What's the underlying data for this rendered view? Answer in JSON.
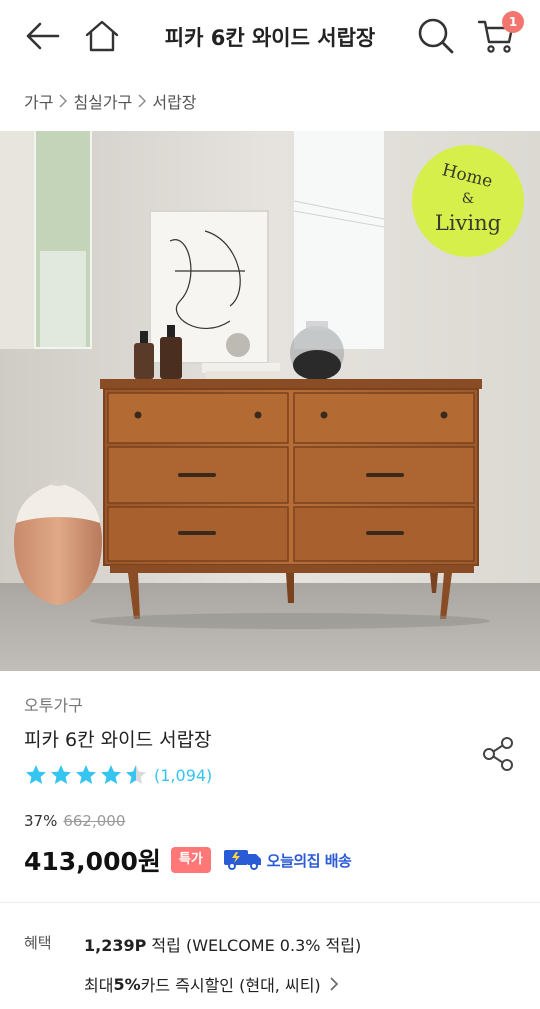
{
  "header": {
    "title": "피카 6칸 와이드 서랍장",
    "cart_count": "1",
    "icons": [
      "back-arrow-icon",
      "home-icon",
      "search-icon",
      "cart-icon"
    ]
  },
  "breadcrumb": [
    "가구",
    "침실가구",
    "서랍장"
  ],
  "hero": {
    "badge_line1": "Home",
    "badge_line2": "&",
    "badge_line3": "Living",
    "badge_color": "#d7ef4a"
  },
  "product": {
    "brand": "오투가구",
    "name": "피카 6칸 와이드 서랍장",
    "rating": 4.5,
    "review_count": "(1,094)",
    "discount": "37%",
    "original_price": "662,000",
    "price": "413,000원",
    "deal_badge": "특가",
    "delivery_label": "오늘의집 배송"
  },
  "benefits": {
    "label": "혜택",
    "points": "1,239P",
    "points_text": " 적립 (WELCOME 0.3% 적립)",
    "card_prefix": "최대 ",
    "card_rate": "5%",
    "card_text": " 카드 즉시할인 (현대, 씨티)"
  },
  "colors": {
    "accent": "#35c5f0",
    "badge": "#f2766f",
    "delivery": "#2a5bd7"
  }
}
